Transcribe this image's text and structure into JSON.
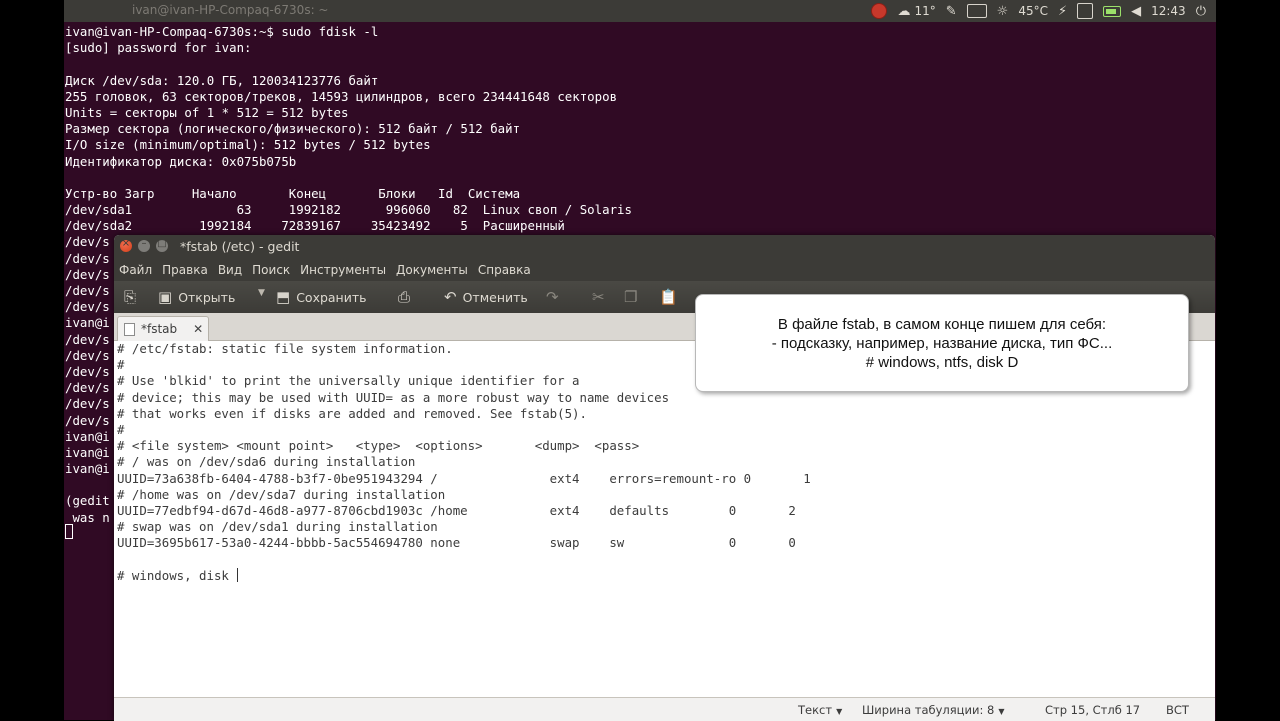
{
  "top_panel": {
    "window_title": "ivan@ivan-HP-Compaq-6730s: ~",
    "weather": "11°",
    "cpu_temp": "45°C",
    "clock": "12:43"
  },
  "terminal": {
    "lines": [
      "ivan@ivan-HP-Compaq-6730s:~$ sudo fdisk -l",
      "[sudo] password for ivan:",
      "",
      "Диск /dev/sda: 120.0 ГБ, 120034123776 байт",
      "255 головок, 63 секторов/треков, 14593 цилиндров, всего 234441648 секторов",
      "Units = секторы of 1 * 512 = 512 bytes",
      "Размер сектора (логического/физического): 512 байт / 512 байт",
      "I/O size (minimum/optimal): 512 bytes / 512 bytes",
      "Идентификатор диска: 0x075b075b",
      "",
      "Устр-во Загр     Начало       Конец       Блоки   Id  Система",
      "/dev/sda1              63     1992182      996060   82  Linux своп / Solaris",
      "/dev/sda2         1992184    72839167    35423492    5  Расширенный",
      "/dev/s",
      "/dev/s",
      "/dev/s",
      "/dev/s",
      "/dev/s",
      "ivan@i",
      "/dev/s",
      "/dev/s",
      "/dev/s",
      "/dev/s",
      "/dev/s",
      "/dev/s",
      "ivan@i",
      "ivan@i",
      "ivan@i",
      "",
      "(gedit",
      " was n"
    ]
  },
  "gedit": {
    "title": "*fstab (/etc) - gedit",
    "menu": [
      "Файл",
      "Правка",
      "Вид",
      "Поиск",
      "Инструменты",
      "Документы",
      "Справка"
    ],
    "toolbar": {
      "open_label": "Открыть",
      "save_label": "Сохранить",
      "undo_label": "Отменить"
    },
    "tab_label": "*fstab",
    "editor_lines": [
      "# /etc/fstab: static file system information.",
      "#",
      "# Use 'blkid' to print the universally unique identifier for a",
      "# device; this may be used with UUID= as a more robust way to name devices",
      "# that works even if disks are added and removed. See fstab(5).",
      "#",
      "# <file system> <mount point>   <type>  <options>       <dump>  <pass>",
      "# / was on /dev/sda6 during installation",
      "UUID=73a638fb-6404-4788-b3f7-0be951943294 /               ext4    errors=remount-ro 0       1",
      "# /home was on /dev/sda7 during installation",
      "UUID=77edbf94-d67d-46d8-a977-8706cbd1903c /home           ext4    defaults        0       2",
      "# swap was on /dev/sda1 during installation",
      "UUID=3695b617-53a0-4244-bbbb-5ac554694780 none            swap    sw              0       0",
      "",
      "# windows, disk "
    ],
    "status": {
      "syntax": "Текст",
      "tab_width": "Ширина табуляции: 8",
      "position": "Стр 15, Стлб 17",
      "insert_mode": "ВСТ"
    }
  },
  "callout": {
    "line1": "В файле fstab, в самом конце пишем для себя:",
    "line2": "- подсказку, например, название диска, тип ФС...",
    "line3": "# windows, ntfs, disk D"
  }
}
